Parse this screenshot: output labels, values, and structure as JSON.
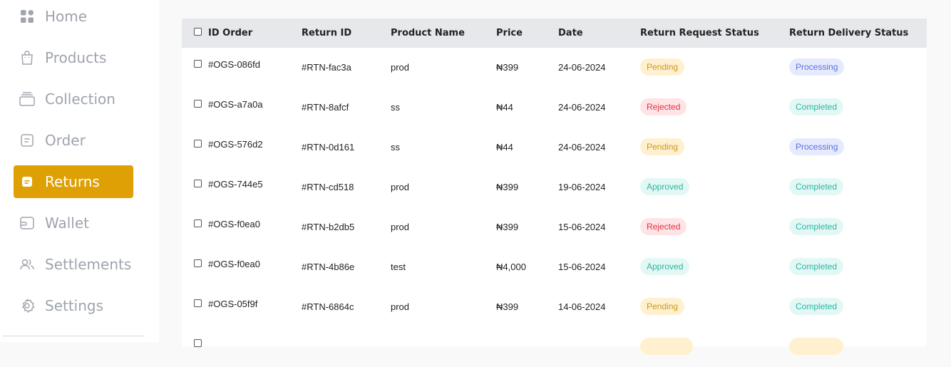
{
  "sidebar": {
    "items": [
      {
        "label": "Home",
        "icon": "grid-icon"
      },
      {
        "label": "Products",
        "icon": "shopping-bag-icon"
      },
      {
        "label": "Collection",
        "icon": "layers-icon"
      },
      {
        "label": "Order",
        "icon": "document-icon"
      },
      {
        "label": "Returns",
        "icon": "return-box-icon",
        "active": true
      },
      {
        "label": "Wallet",
        "icon": "wallet-icon"
      },
      {
        "label": "Settlements",
        "icon": "users-icon"
      },
      {
        "label": "Settings",
        "icon": "gear-icon"
      }
    ],
    "active_color": "#dea004"
  },
  "table": {
    "headers": {
      "id_order": "ID Order",
      "return_id": "Return ID",
      "product_name": "Product Name",
      "price": "Price",
      "date": "Date",
      "return_request_status": "Return Request Status",
      "return_delivery_status": "Return Delivery Status"
    },
    "rows": [
      {
        "id_order": "#OGS-086fd",
        "return_id": "#RTN-fac3a",
        "product_name": "prod",
        "price": "₦399",
        "date": "24-06-2024",
        "request_status": "Pending",
        "delivery_status": "Processing"
      },
      {
        "id_order": "#OGS-a7a0a",
        "return_id": "#RTN-8afcf",
        "product_name": "ss",
        "price": "₦44",
        "date": "24-06-2024",
        "request_status": "Rejected",
        "delivery_status": "Completed"
      },
      {
        "id_order": "#OGS-576d2",
        "return_id": "#RTN-0d161",
        "product_name": "ss",
        "price": "₦44",
        "date": "24-06-2024",
        "request_status": "Pending",
        "delivery_status": "Processing"
      },
      {
        "id_order": "#OGS-744e5",
        "return_id": "#RTN-cd518",
        "product_name": "prod",
        "price": "₦399",
        "date": "19-06-2024",
        "request_status": "Approved",
        "delivery_status": "Completed"
      },
      {
        "id_order": "#OGS-f0ea0",
        "return_id": "#RTN-b2db5",
        "product_name": "prod",
        "price": "₦399",
        "date": "15-06-2024",
        "request_status": "Rejected",
        "delivery_status": "Completed"
      },
      {
        "id_order": "#OGS-f0ea0",
        "return_id": "#RTN-4b86e",
        "product_name": "test",
        "price": "₦4,000",
        "date": "15-06-2024",
        "request_status": "Approved",
        "delivery_status": "Completed"
      },
      {
        "id_order": "#OGS-05f9f",
        "return_id": "#RTN-6864c",
        "product_name": "prod",
        "price": "₦399",
        "date": "14-06-2024",
        "request_status": "Pending",
        "delivery_status": "Completed"
      }
    ],
    "status_colors": {
      "Pending": "#c99a1f",
      "Rejected": "#e03145",
      "Approved": "#2bb5a3",
      "Processing": "#5b6fe0",
      "Completed": "#2bb5a3"
    }
  }
}
